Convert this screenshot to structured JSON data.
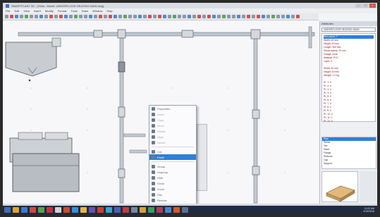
{
  "window": {
    "title": "SMARTPLANT 3D - [Tekla - Model: UNDERFLOOR HEATING MAIN.dwg]"
  },
  "menu": [
    "File",
    "Edit",
    "View",
    "Insert",
    "Modify",
    "Format",
    "Tools",
    "Draw",
    "Window",
    "Help"
  ],
  "context_menu": {
    "items": [
      {
        "label": "Properties",
        "dim": false,
        "selected": false
      },
      {
        "label": "Insert",
        "dim": true,
        "selected": false
      },
      {
        "label": "Copy",
        "dim": true,
        "selected": false
      },
      {
        "label": "Move",
        "dim": true,
        "selected": false
      },
      {
        "label": "Rotate",
        "dim": true,
        "selected": false
      },
      {
        "label": "Align",
        "dim": true,
        "selected": false
      },
      {
        "label": "Delete",
        "dim": true,
        "selected": false
      },
      {
        "label": "Cut",
        "dim": false,
        "selected": false
      },
      {
        "label": "Paste",
        "dim": false,
        "selected": true
      },
      {
        "label": "Group",
        "dim": false,
        "selected": false
      },
      {
        "label": "Ungroup",
        "dim": false,
        "selected": false
      },
      {
        "label": "Hide",
        "dim": false,
        "selected": false
      },
      {
        "label": "Show",
        "dim": false,
        "selected": false
      },
      {
        "label": "Zoom",
        "dim": false,
        "selected": false
      },
      {
        "label": "Pan",
        "dim": false,
        "selected": false
      },
      {
        "label": "Redraw",
        "dim": false,
        "selected": false
      }
    ]
  },
  "panel": {
    "header": "Attributes",
    "selector": "UNDERFLOOR HEATING MAIN",
    "props": [
      "Item name: T",
      "Width: 40 mm",
      "Height: 40 mm",
      "Length: 300 mm",
      "Elbow radius: 20 mm",
      "Flange: none",
      "Material: PVC",
      "Layer: 0",
      "",
      "Width: 40 mm",
      "Height: 40 mm",
      "Weight: 1.2 kg",
      "",
      "Pt. 1: 0",
      "Pt. 2: 0",
      "Pt. 3: 0",
      "Pt. 4: 0",
      "Pt. 5: 0",
      "Pt. 6: 0",
      "Pt. 7: 0",
      "Pt. 8: 0",
      "Pt. 9: 0",
      "Pt. 10: 0",
      "Pt. 11: 0",
      "Pt. 12: 0"
    ],
    "lib_items": [
      "Pipe",
      "Elbow",
      "Tee",
      "Valve",
      "Flange",
      "Reducer",
      "Cap",
      "Support"
    ]
  },
  "taskbar": {
    "time": "11:02 AM",
    "date": "4/19/2016"
  },
  "colors": {
    "accent": "#2f7fd8",
    "taskbar": "#1f2b3f",
    "props_text": "#8b1d2c"
  }
}
